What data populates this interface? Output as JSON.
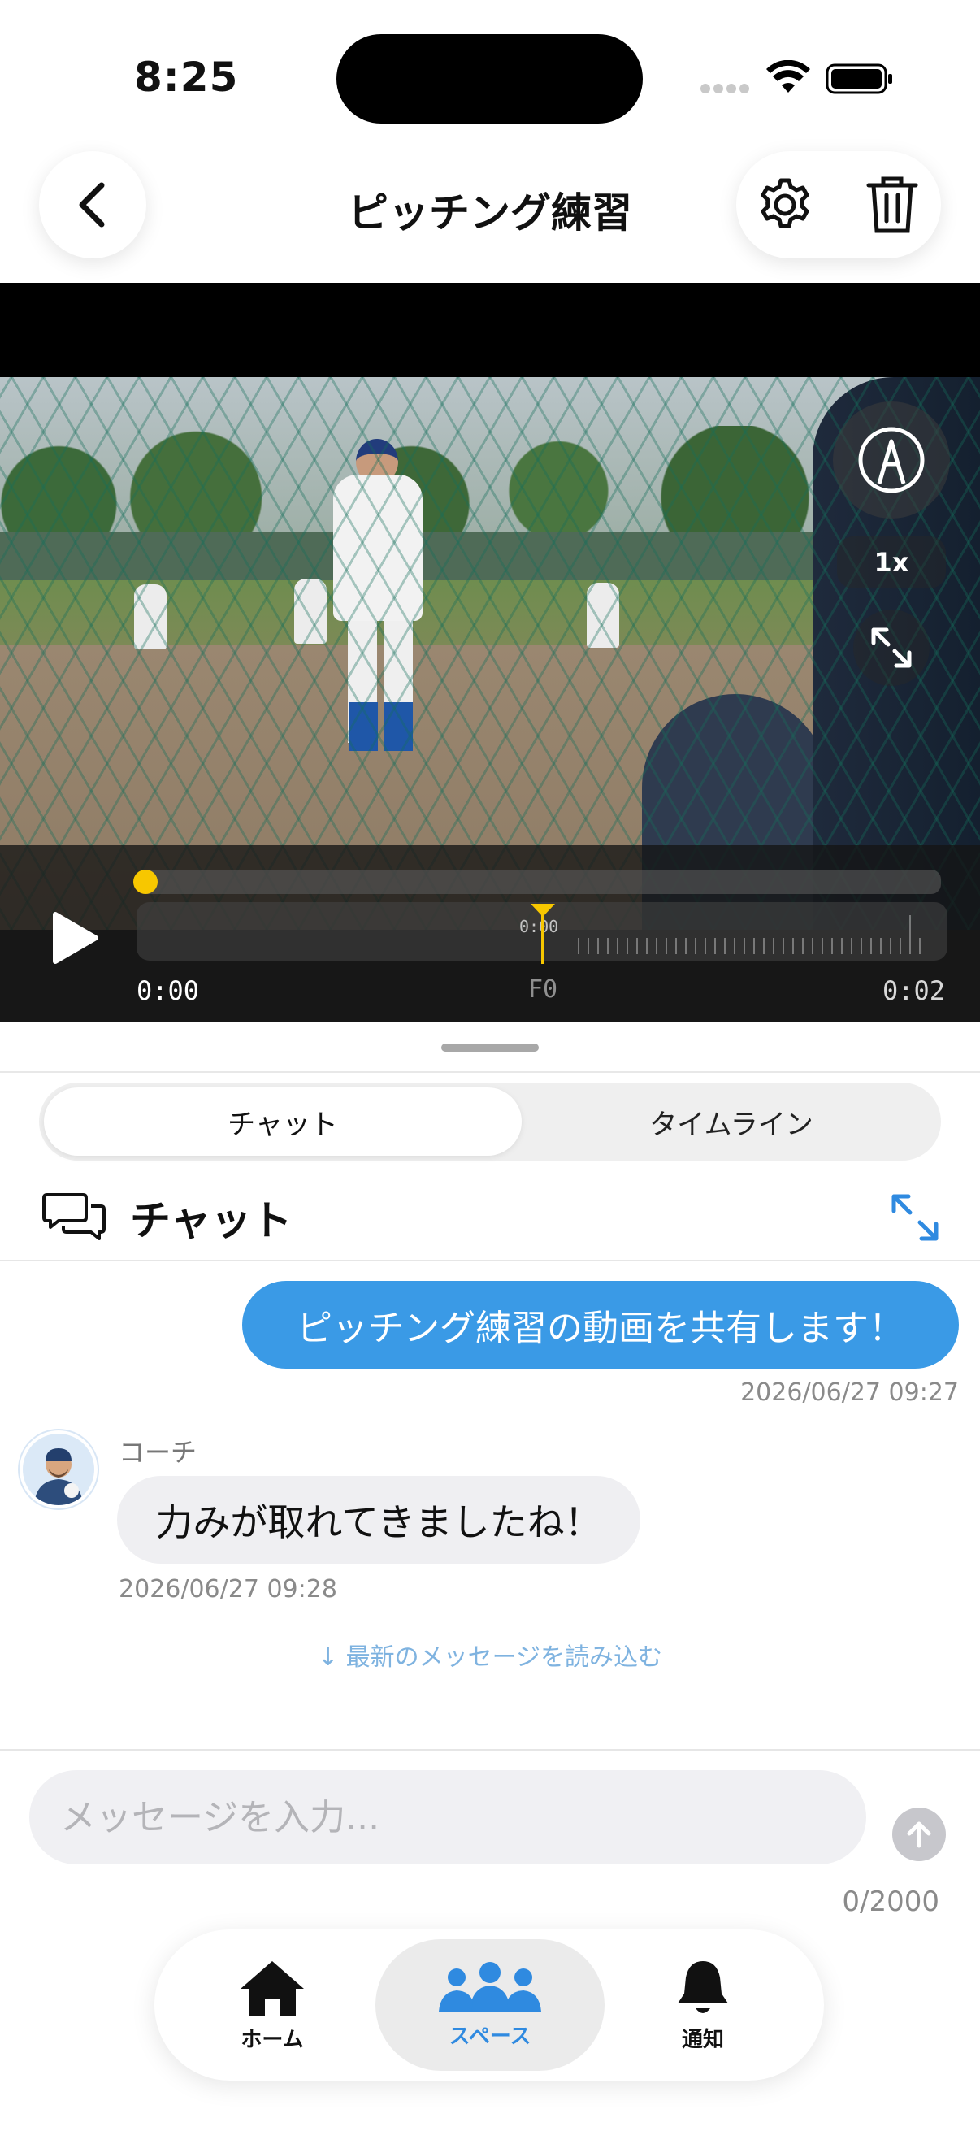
{
  "status_bar": {
    "time": "8:25"
  },
  "header": {
    "title": "ピッチング練習"
  },
  "video": {
    "speed": "1x",
    "current_time": "0:00",
    "duration": "0:02",
    "frame_label": "F0",
    "playhead_time": "0:00",
    "progress": 0
  },
  "tabs": {
    "chat": "チャット",
    "timeline": "タイムライン",
    "active": "chat"
  },
  "chat": {
    "title": "チャット",
    "messages": [
      {
        "direction": "sent",
        "text": "ピッチング練習の動画を共有します！",
        "timestamp": "2026/06/27 09:27"
      },
      {
        "direction": "received",
        "sender": "コーチ",
        "text": "力みが取れてきましたね！",
        "timestamp": "2026/06/27 09:28"
      }
    ],
    "load_latest": "↓ 最新のメッセージを読み込む"
  },
  "composer": {
    "placeholder": "メッセージを入力...",
    "value": "",
    "char_count": "0/2000"
  },
  "tab_bar": {
    "items": [
      {
        "label": "ホーム",
        "icon": "house-icon",
        "active": false
      },
      {
        "label": "スペース",
        "icon": "people-icon",
        "active": true
      },
      {
        "label": "通知",
        "icon": "bell-icon",
        "active": false
      }
    ]
  },
  "colors": {
    "accent": "#3a9ae6",
    "playhead": "#f7c700",
    "tab_active": "#2f8ae0"
  }
}
